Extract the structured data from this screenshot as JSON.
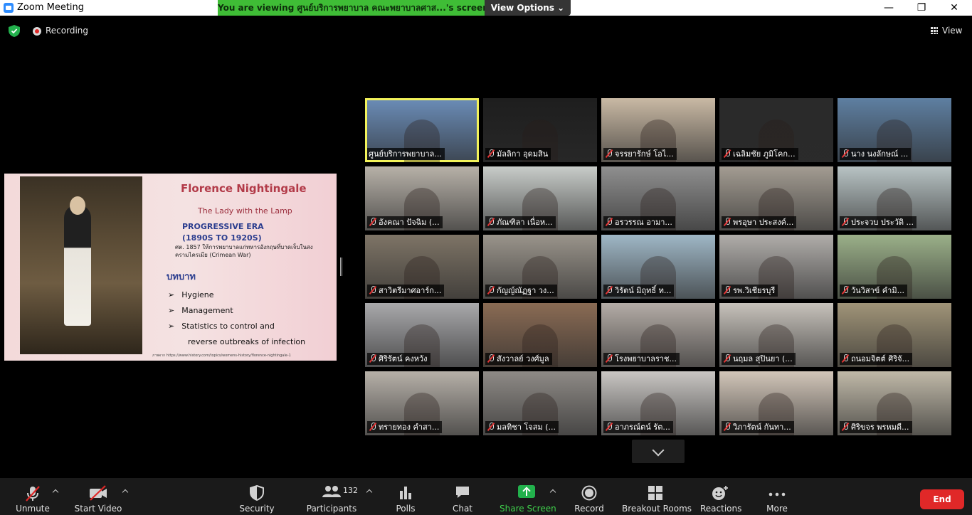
{
  "window": {
    "title": "Zoom Meeting"
  },
  "share_banner": {
    "text": "You are viewing ศูนย์บริการพยาบาล คณะพยาบาลศาส...'s screen",
    "view_options": "View Options ⌄"
  },
  "status": {
    "recording_label": "Recording",
    "view_label": "View"
  },
  "slide": {
    "title": "Florence Nightingale",
    "subtitle": "The Lady with the Lamp",
    "era": "PROGRESSIVE ERA",
    "years": "(1890S TO 1920S)",
    "bullet1": "ศต. 1857 ให้การพยาบาลแก่ทหารอังกฤษที่บาดเจ็บในสงครามไครเมีย (Crimean War)",
    "role_heading": "บทบาท",
    "roles": [
      "Hygiene",
      "Management",
      "Statistics to control and",
      "reverse outbreaks of infection"
    ],
    "source": "ภาพจาก https://www.history.com/topics/womens-history/florence-nightingale-1"
  },
  "participants_grid": [
    {
      "name": "ศูนย์บริการพยาบาล...",
      "muted": false,
      "bg": "#6b8db8",
      "active": true
    },
    {
      "name": "มัลลิกา  อุดมสิน",
      "muted": true,
      "bg": "#1e1e1e"
    },
    {
      "name": "จรรยารักษ์ โอไ...",
      "muted": true,
      "bg": "#c9b9a4"
    },
    {
      "name": "เฉลิมชัย ภูมิโคก...",
      "muted": true,
      "bg": "#2a2a2a"
    },
    {
      "name": "นาง นงลักษณ์  ...",
      "muted": true,
      "bg": "#5e7fa1"
    },
    {
      "name": "อังคณา ปัจฉิม (...",
      "muted": true,
      "bg": "#b7b1a8"
    },
    {
      "name": "ภัณฑิลา เนื่อห...",
      "muted": true,
      "bg": "#c8ccc9"
    },
    {
      "name": "อรวรรณ อามา...",
      "muted": true,
      "bg": "#8f8f8f"
    },
    {
      "name": "พรอุษา ประสงค์...",
      "muted": true,
      "bg": "#a39c92"
    },
    {
      "name": "ประจวบ ประวัติ ...",
      "muted": true,
      "bg": "#b8c3c4"
    },
    {
      "name": "สาวิตรีมาศอาร์ก...",
      "muted": true,
      "bg": "#7e7466"
    },
    {
      "name": "กัญญ์ณัฏฐา วง...",
      "muted": true,
      "bg": "#9a948b"
    },
    {
      "name": "วิรัตน์ มิถุทธิ์ ท...",
      "muted": true,
      "bg": "#9fb7c6"
    },
    {
      "name": "รพ.วิเชียรบุรี",
      "muted": true,
      "bg": "#b0adaa"
    },
    {
      "name": "วันวิสาข์ คำมิ...",
      "muted": true,
      "bg": "#9bb089"
    },
    {
      "name": "ศิริรัตน์ คงหวัง",
      "muted": true,
      "bg": "#a9a9ab"
    },
    {
      "name": "สังวาลย์ วงศ์มูล",
      "muted": true,
      "bg": "#8a6b54"
    },
    {
      "name": "โรงพยาบาลราช...",
      "muted": true,
      "bg": "#b4aca6"
    },
    {
      "name": "นฤมล สุปินยา (...",
      "muted": true,
      "bg": "#c7c2bb"
    },
    {
      "name": "ถนอมจิตต์ ศิริจั...",
      "muted": true,
      "bg": "#a09478"
    },
    {
      "name": "ทรายทอง คำสา...",
      "muted": true,
      "bg": "#b6b0a8"
    },
    {
      "name": "มลทิชา โจสม (...",
      "muted": true,
      "bg": "#8e8a86"
    },
    {
      "name": "อาภรณ์ตน์ รัต...",
      "muted": true,
      "bg": "#c9c6c3"
    },
    {
      "name": "วิภารัตน์ กันทา...",
      "muted": true,
      "bg": "#d2c6b9"
    },
    {
      "name": "ศิริขจร พรหมดี...",
      "muted": true,
      "bg": "#c0b9a8"
    }
  ],
  "toolbar": {
    "unmute": "Unmute",
    "start_video": "Start Video",
    "security": "Security",
    "participants": "Participants",
    "participants_count": "132",
    "polls": "Polls",
    "chat": "Chat",
    "share_screen": "Share Screen",
    "record": "Record",
    "breakout_rooms": "Breakout Rooms",
    "reactions": "Reactions",
    "more": "More",
    "end": "End"
  },
  "colors": {
    "share_green": "#3fbd36",
    "end_red": "#e02828",
    "active_speaker": "#f2f25a",
    "mute_red": "#e23535"
  }
}
